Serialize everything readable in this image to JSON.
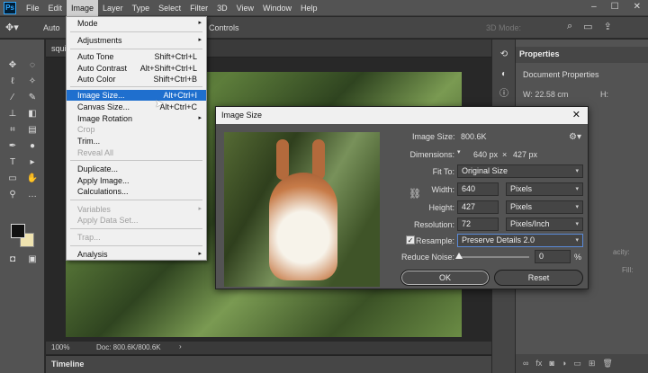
{
  "menubar": {
    "logo": "Ps",
    "items": [
      "File",
      "Edit",
      "Image",
      "Layer",
      "Type",
      "Select",
      "Filter",
      "3D",
      "View",
      "Window",
      "Help"
    ],
    "active": "Image",
    "win_min": "–",
    "win_max": "☐",
    "win_close": "✕"
  },
  "options": {
    "auto": "Auto",
    "controls": "Controls",
    "mode_3d": "3D Mode:"
  },
  "document": {
    "tab": "squi",
    "zoom": "100%",
    "doc_size": "Doc: 800.6K/800.6K",
    "arrow": "›"
  },
  "timeline": "Timeline",
  "properties": {
    "title": "Properties",
    "doc_props": "Document Properties",
    "w": "W:  22.58 cm",
    "h": "H:",
    "identity": "acity:",
    "fill": "Fill:"
  },
  "image_menu": [
    {
      "label": "Mode",
      "arrow": "▸"
    },
    {
      "label": "Adjustments",
      "arrow": "▸"
    },
    {
      "label": "Auto Tone",
      "shortcut": "Shift+Ctrl+L"
    },
    {
      "label": "Auto Contrast",
      "shortcut": "Alt+Shift+Ctrl+L"
    },
    {
      "label": "Auto Color",
      "shortcut": "Shift+Ctrl+B"
    },
    {
      "label": "Image Size...",
      "shortcut": "Alt+Ctrl+I"
    },
    {
      "label": "Canvas Size...",
      "shortcut": "Alt+Ctrl+C"
    },
    {
      "label": "Image Rotation",
      "arrow": "▸"
    },
    {
      "label": "Crop"
    },
    {
      "label": "Trim..."
    },
    {
      "label": "Reveal All"
    },
    {
      "label": "Duplicate..."
    },
    {
      "label": "Apply Image..."
    },
    {
      "label": "Calculations..."
    },
    {
      "label": "Variables",
      "arrow": "▸"
    },
    {
      "label": "Apply Data Set..."
    },
    {
      "label": "Trap..."
    },
    {
      "label": "Analysis",
      "arrow": "▸"
    }
  ],
  "dialog": {
    "title": "Image Size",
    "close": "✕",
    "image_size_label": "Image Size:",
    "image_size_value": "800.6K",
    "dimensions_label": "Dimensions:",
    "dimensions_w": "640 px",
    "dimensions_x": "×",
    "dimensions_h": "427 px",
    "fit_to_label": "Fit To:",
    "fit_to_value": "Original Size",
    "width_label": "Width:",
    "width_value": "640",
    "width_unit": "Pixels",
    "height_label": "Height:",
    "height_value": "427",
    "height_unit": "Pixels",
    "resolution_label": "Resolution:",
    "resolution_value": "72",
    "resolution_unit": "Pixels/Inch",
    "resample_label": "Resample:",
    "resample_checked": "✓",
    "resample_value": "Preserve Details 2.0",
    "noise_label": "Reduce Noise:",
    "noise_value": "0",
    "noise_unit": "%",
    "ok": "OK",
    "reset": "Reset"
  }
}
